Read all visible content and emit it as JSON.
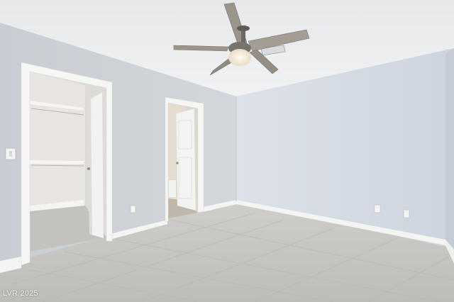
{
  "photo": {
    "watermark": "LVR 2025"
  },
  "colors": {
    "ceiling": "#eceef0",
    "left_wall": "#cfd3d8",
    "right_wall": "#d5dbe3",
    "floor": "#c9c8c4",
    "trim": "#f6f6f4",
    "door": "#f3f3f1",
    "closet_wall": "#e5e2df",
    "fan_blade": "#9a948b"
  },
  "icons": [
    "ceiling-fan-icon",
    "light-switch-icon",
    "outlet-icon"
  ]
}
